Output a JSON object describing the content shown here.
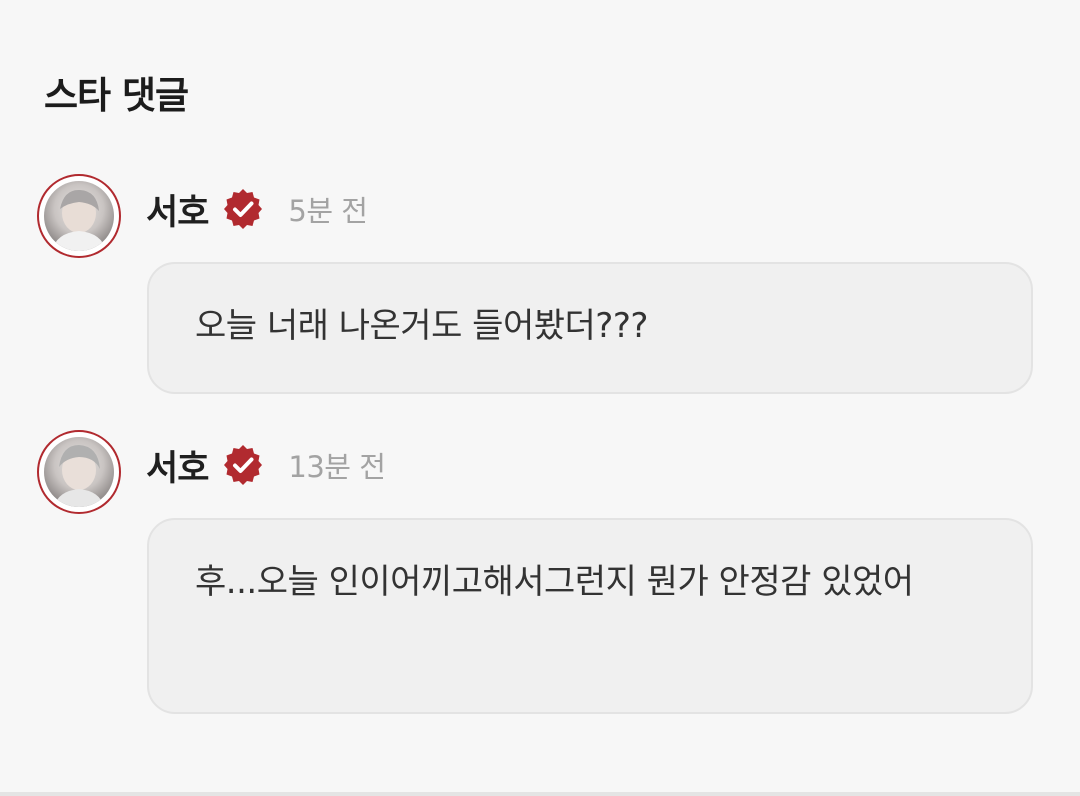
{
  "section": {
    "title": "스타 댓글"
  },
  "comments": [
    {
      "author": "서호",
      "verified_icon": "verified-badge-icon",
      "time": "5분 전",
      "text": "오늘 너래 나온거도 들어봤더???"
    },
    {
      "author": "서호",
      "verified_icon": "verified-badge-icon",
      "time": "13분 전",
      "text": "후...오늘 인이어끼고해서그런지 뭔가 안정감 있었어"
    }
  ],
  "colors": {
    "background": "#f7f7f7",
    "bubble": "#f0f0f0",
    "bubble_border": "#e3e3e3",
    "accent_red": "#b12a2f",
    "time_gray": "#a3a3a3"
  }
}
